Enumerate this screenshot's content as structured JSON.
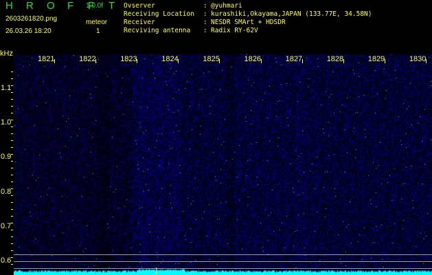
{
  "header": {
    "title_letters": [
      "H",
      "R",
      "O",
      "F",
      "F",
      "T"
    ],
    "version": "1.0.0f",
    "filename": "2603261820.png",
    "datetime": "26.03.26 18:20",
    "meteor_label": "meteor",
    "meteor_count": "1"
  },
  "info": {
    "observer_label": "Ovserver",
    "observer": "@yuhmari",
    "location_label": "Receiving Location",
    "location": "kurashiki,Okayama,JAPAN (133.77E, 34.58N)",
    "receiver_label": "Receiver",
    "receiver": "NESDR SMArt + HDSDR",
    "antenna_label": "Recviving antenna",
    "antenna": "Radix RY-62V",
    "separator": ":"
  },
  "axis": {
    "unit": "kHz",
    "freq_labels": [
      "1821",
      "1822",
      "1823",
      "1824",
      "1825",
      "1826",
      "1827",
      "1828",
      "1829",
      "1830"
    ],
    "y_labels": [
      "1.1",
      "1.0",
      "0.9",
      "0.8",
      "0.7",
      "0.6"
    ]
  },
  "colors": {
    "accent_green": "#22e030",
    "label_yellow": "#ffff40",
    "signal_cyan": "#00ffff",
    "noise_blue": "#2030ff"
  }
}
